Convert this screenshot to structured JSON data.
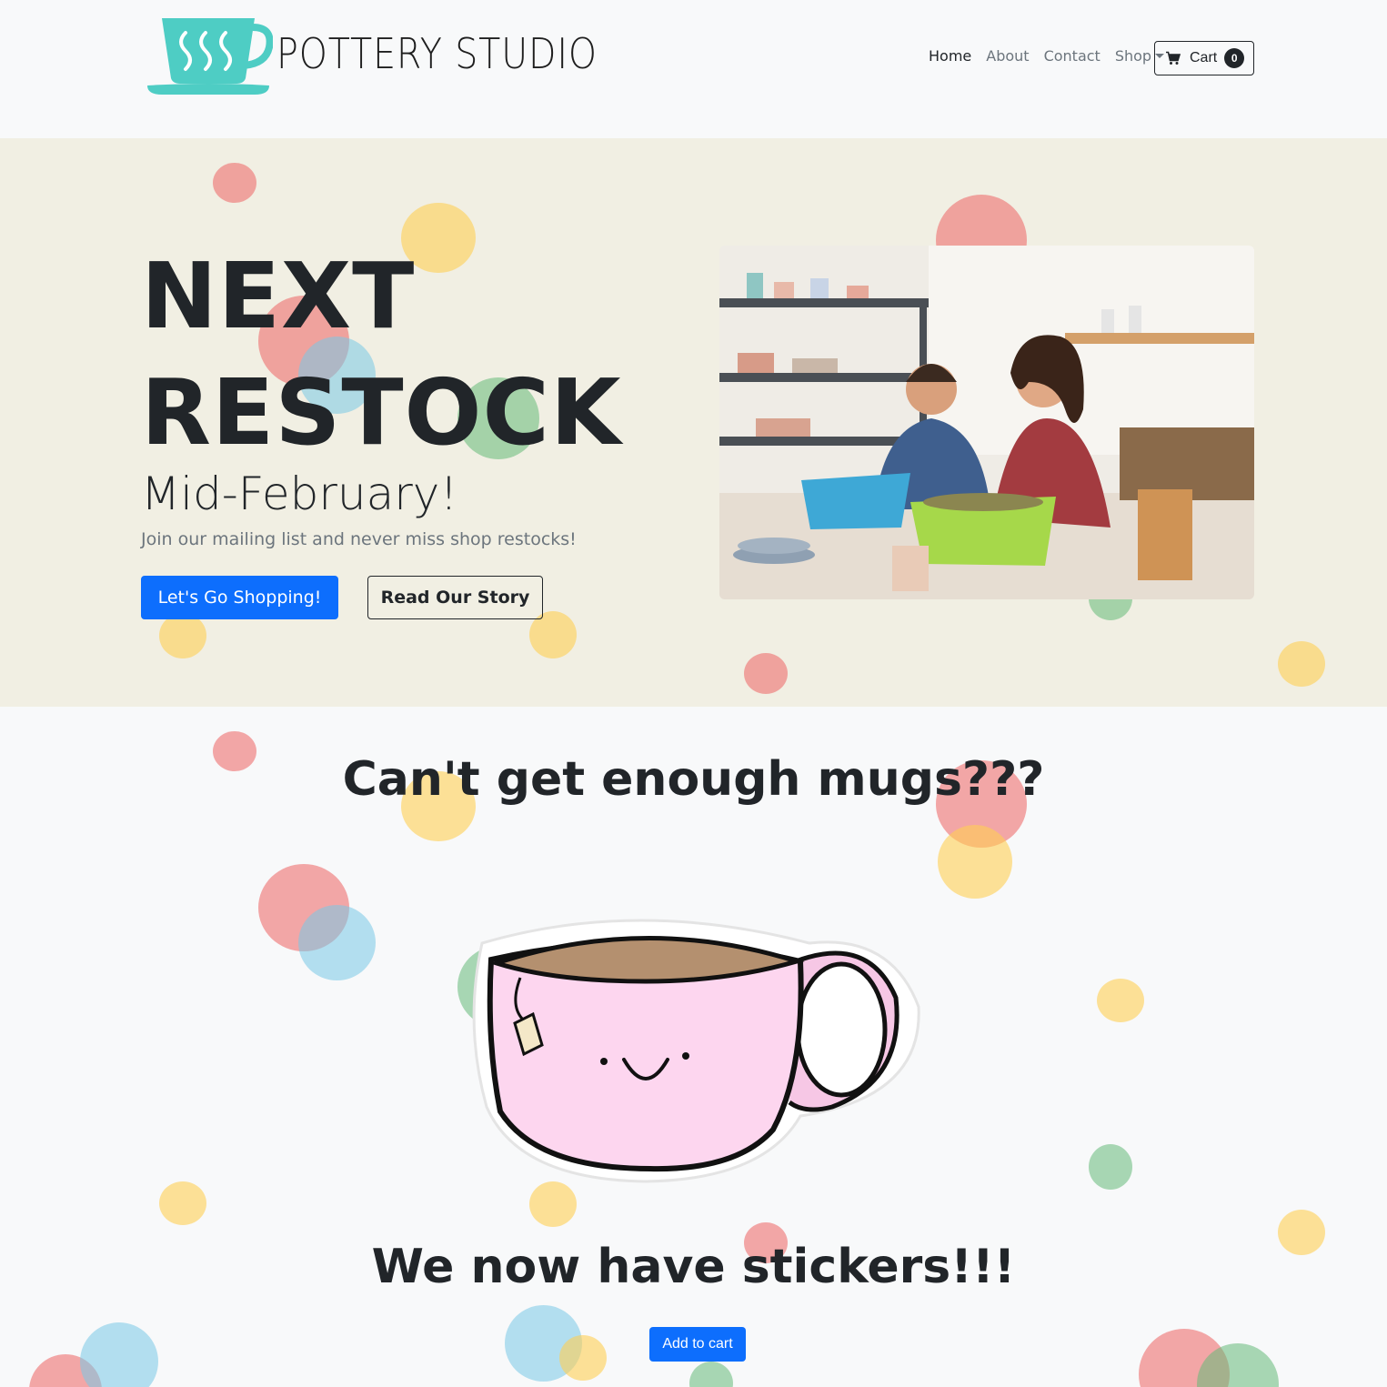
{
  "brand": {
    "name": "POTTERY STUDIO"
  },
  "nav": {
    "items": [
      {
        "label": "Home",
        "active": true
      },
      {
        "label": "About"
      },
      {
        "label": "Contact"
      }
    ],
    "shop_label": "Shop",
    "cart_label": "Cart",
    "cart_count": "0"
  },
  "hero": {
    "title_line1": "NEXT",
    "title_line2": "RESTOCK",
    "subtitle": "Mid-February!",
    "lead": "Join our mailing list and never miss shop restocks!",
    "primary_button": "Let's Go Shopping!",
    "secondary_button": "Read Our Story"
  },
  "promo": {
    "heading1": "Can't get enough mugs???",
    "heading2": "We now have stickers!!!",
    "button": "Add to cart"
  },
  "colors": {
    "primary": "#0d6efd",
    "hero_bg": "#f1efe3",
    "logo_teal": "#4ecdc4",
    "mug_pink": "#fdd6ef"
  },
  "icons": [
    "cup-logo-icon",
    "cart-icon",
    "caret-down-icon"
  ]
}
